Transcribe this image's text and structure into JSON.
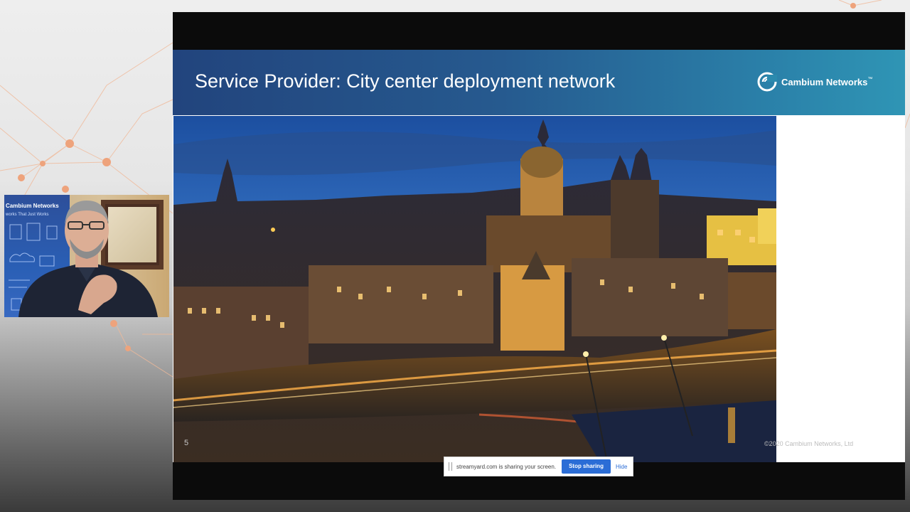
{
  "slide": {
    "title": "Service Provider: City center deployment network",
    "logo_text": "Cambium Networks",
    "logo_tm": "™",
    "slide_number": "5",
    "copyright": "©2020 Cambium Networks, Ltd"
  },
  "webcam": {
    "banner_brand": "Cambium Networks",
    "banner_tagline": "works That Just Works"
  },
  "share_bar": {
    "message": "streamyard.com is sharing your screen.",
    "stop_label": "Stop sharing",
    "hide_label": "Hide"
  },
  "icons": {
    "logo": "cambium-logo-icon",
    "grip": "drag-grip-icon"
  },
  "colors": {
    "header_start": "#22447d",
    "header_end": "#2f95b5",
    "stop_button": "#2b6dd6",
    "network_accent": "#e9a27a"
  }
}
